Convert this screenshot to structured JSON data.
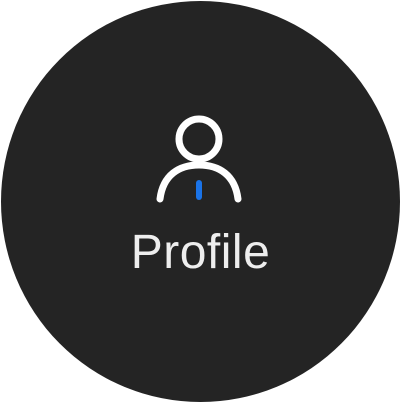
{
  "profile_button": {
    "label": "Profile",
    "icon": "user-icon",
    "background_color": "#242424",
    "icon_color": "#ffffff",
    "accent_color": "#1a73e8"
  }
}
